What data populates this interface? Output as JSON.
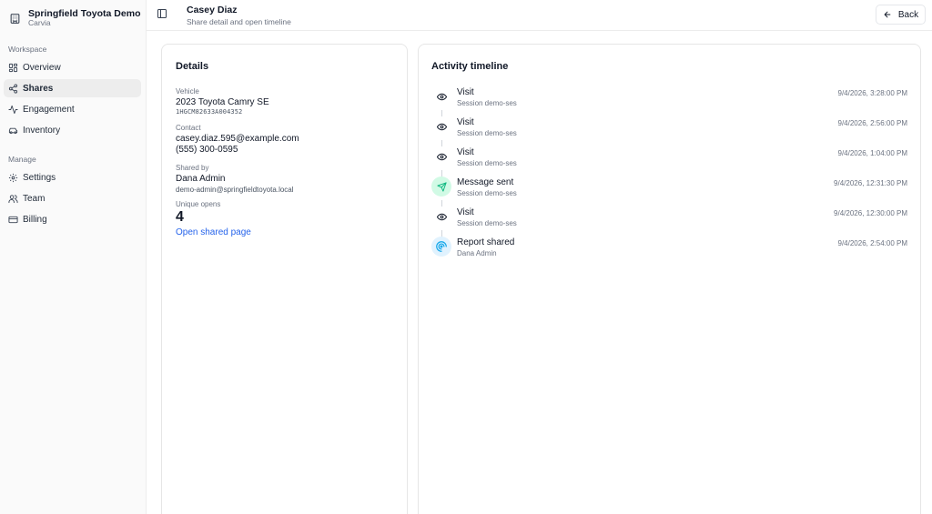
{
  "sidebar": {
    "brand_name": "Springfield Toyota Demo",
    "brand_sub": "Carvia",
    "workspace_label": "Workspace",
    "manage_label": "Manage",
    "workspace_items": [
      {
        "label": "Overview",
        "icon": "grid-icon"
      },
      {
        "label": "Shares",
        "icon": "share-icon",
        "active": true
      },
      {
        "label": "Engagement",
        "icon": "activity-icon"
      },
      {
        "label": "Inventory",
        "icon": "car-icon"
      }
    ],
    "manage_items": [
      {
        "label": "Settings",
        "icon": "gear-icon"
      },
      {
        "label": "Team",
        "icon": "users-icon"
      },
      {
        "label": "Billing",
        "icon": "credit-card-icon"
      }
    ]
  },
  "header": {
    "title": "Casey Diaz",
    "subtitle": "Share detail and open timeline",
    "back_label": "Back"
  },
  "details": {
    "title": "Details",
    "vehicle_label": "Vehicle",
    "vehicle_value": "2023 Toyota Camry SE",
    "vin": "1HGCM82633A004352",
    "contact_label": "Contact",
    "contact_email": "casey.diaz.595@example.com",
    "contact_phone": "(555) 300-0595",
    "shared_by_label": "Shared by",
    "shared_by_name": "Dana Admin",
    "shared_by_email": "demo-admin@springfieldtoyota.local",
    "unique_opens_label": "Unique opens",
    "unique_opens_value": "4",
    "open_link": "Open shared page"
  },
  "timeline": {
    "title": "Activity timeline",
    "items": [
      {
        "title": "Visit",
        "sub": "Session demo-ses",
        "time": "9/4/2026, 3:28:00 PM",
        "icon": "eye-icon"
      },
      {
        "title": "Visit",
        "sub": "Session demo-ses",
        "time": "9/4/2026, 2:56:00 PM",
        "icon": "eye-icon"
      },
      {
        "title": "Visit",
        "sub": "Session demo-ses",
        "time": "9/4/2026, 1:04:00 PM",
        "icon": "eye-icon"
      },
      {
        "title": "Message sent",
        "sub": "Session demo-ses",
        "time": "9/4/2026, 12:31:30 PM",
        "icon": "send-icon"
      },
      {
        "title": "Visit",
        "sub": "Session demo-ses",
        "time": "9/4/2026, 12:30:00 PM",
        "icon": "eye-icon"
      },
      {
        "title": "Report shared",
        "sub": "Dana Admin",
        "time": "9/4/2026, 2:54:00 PM",
        "icon": "report-icon"
      }
    ]
  },
  "colors": {
    "accent_link": "#2563eb",
    "message_icon_bg": "#d1fae5",
    "message_icon_fg": "#10b981",
    "report_icon_bg": "#e0f2fe",
    "report_icon_fg": "#0ea5e9"
  }
}
